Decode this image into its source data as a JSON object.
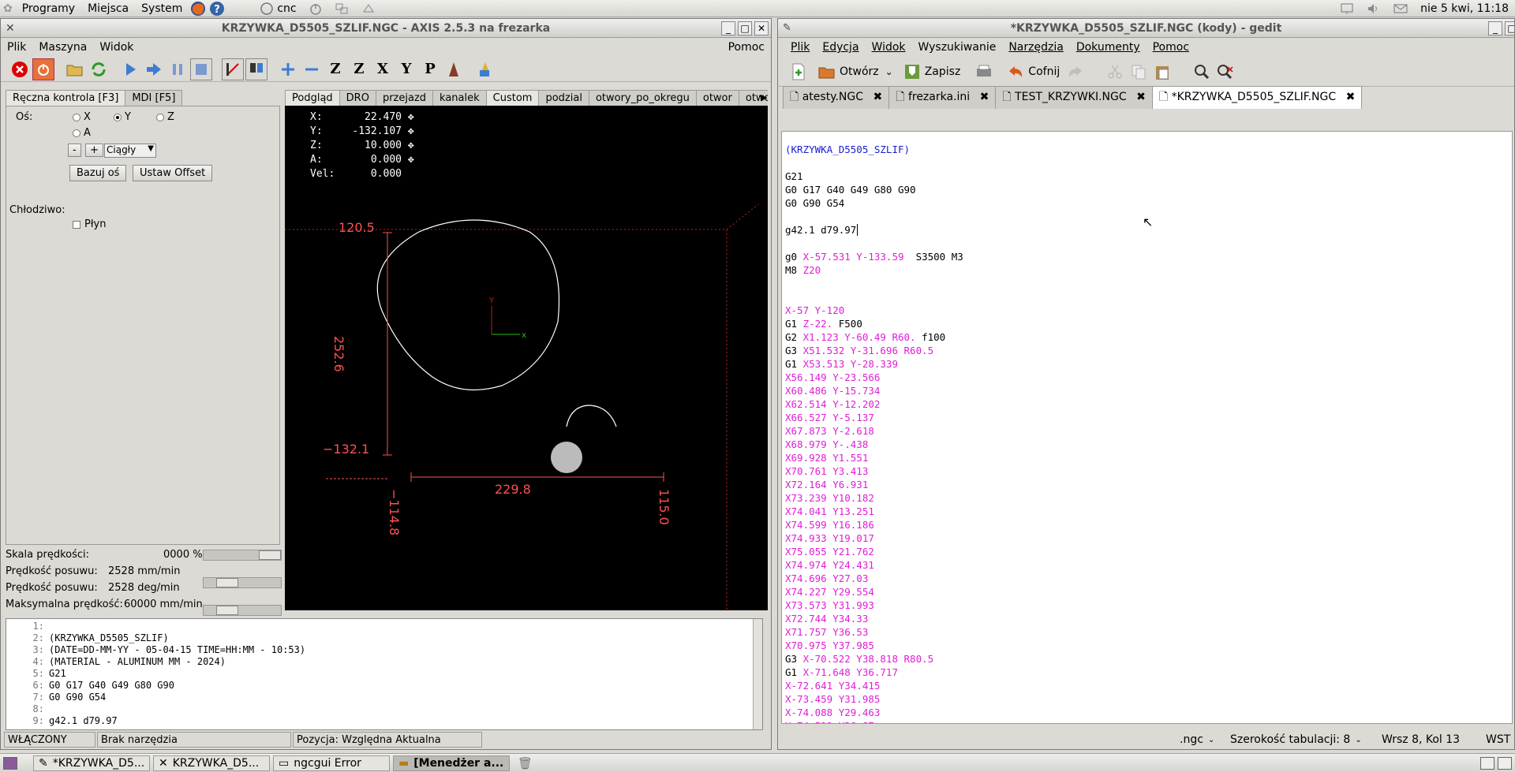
{
  "top_panel": {
    "menu_programs": "Programy",
    "menu_places": "Miejsca",
    "menu_system": "System",
    "launcher_cnc": "cnc",
    "clock": "nie 5 kwi, 11:18"
  },
  "axis": {
    "title": "KRZYWKA_D5505_SZLIF.NGC - AXIS 2.5.3 na frezarka",
    "menu": [
      "Plik",
      "Maszyna",
      "Widok"
    ],
    "menu_help": "Pomoc",
    "manual_tab": "Ręczna kontrola [F3]",
    "mdi_tab": "MDI [F5]",
    "axis_label": "Oś:",
    "axes": [
      "X",
      "Y",
      "Z",
      "A"
    ],
    "selected_axis": "Y",
    "jog_minus": "-",
    "jog_plus": "+",
    "jog_mode": "Ciągły",
    "home_button": "Bazuj oś",
    "offset_button": "Ustaw Offset",
    "coolant_label": "Chłodziwo:",
    "flood_label": "Płyn",
    "speed_scale_label": "Skala prędkości:",
    "speed_scale_value": "0000 %",
    "feed_label_1": "Prędkość posuwu:",
    "feed_value_1": "2528 mm/min",
    "feed_label_2": "Prędkość posuwu:",
    "feed_value_2": "2528 deg/min",
    "max_speed_label": "Maksymalna prędkość:",
    "max_speed_value": "60000 mm/min",
    "view_tabs": [
      "Podgląd",
      "DRO",
      "przejazd",
      "kanalek",
      "Custom",
      "podzial",
      "otwory_po_okregu",
      "otwor",
      "otwory_lini"
    ],
    "active_view_tab": "Podgląd",
    "dro": [
      {
        "label": "X:",
        "value": "22.470"
      },
      {
        "label": "Y:",
        "value": "-132.107"
      },
      {
        "label": "Z:",
        "value": "10.000"
      },
      {
        "label": "A:",
        "value": "0.000"
      },
      {
        "label": "Vel:",
        "value": "0.000"
      }
    ],
    "dims": {
      "top": "120.5",
      "height": "252.6",
      "bottom": "−132.1",
      "width": "229.8",
      "left": "−114.8",
      "right": "115.0"
    },
    "gcode_lines": [
      {
        "n": "1:",
        "t": ""
      },
      {
        "n": "2:",
        "t": "(KRZYWKA_D5505_SZLIF)"
      },
      {
        "n": "3:",
        "t": "(DATE=DD-MM-YY - 05-04-15 TIME=HH:MM - 10:53)"
      },
      {
        "n": "4:",
        "t": "(MATERIAL - ALUMINUM MM - 2024)"
      },
      {
        "n": "5:",
        "t": "G21"
      },
      {
        "n": "6:",
        "t": "G0 G17 G40 G49 G80 G90"
      },
      {
        "n": "7:",
        "t": "G0 G90 G54"
      },
      {
        "n": "8:",
        "t": ""
      },
      {
        "n": "9:",
        "t": "g42.1 d79.97"
      }
    ],
    "status": {
      "state": "WŁĄCZONY",
      "tool": "Brak narzędzia",
      "position": "Pozycja: Względna Aktualna"
    }
  },
  "gedit": {
    "title": "*KRZYWKA_D5505_SZLIF.NGC (kody) - gedit",
    "menu": [
      "Plik",
      "Edycja",
      "Widok",
      "Wyszukiwanie",
      "Narzędzia",
      "Dokumenty",
      "Pomoc"
    ],
    "toolbar": {
      "open": "Otwórz",
      "save": "Zapisz",
      "undo": "Cofnij"
    },
    "tabs": [
      "atesty.NGC",
      "frezarka.ini",
      "TEST_KRZYWKI.NGC",
      "*KRZYWKA_D5505_SZLIF.NGC"
    ],
    "lines": [
      [
        {
          "c": "b",
          "t": "(KRZYWKA_D5505_SZLIF)"
        }
      ],
      [],
      [
        {
          "c": "k",
          "t": "G21"
        }
      ],
      [
        {
          "c": "k",
          "t": "G0 G17 G40 G49 G80 G90"
        }
      ],
      [
        {
          "c": "k",
          "t": "G0 G90 G54"
        }
      ],
      [],
      [
        {
          "c": "k",
          "t": "g42.1 d79.97"
        }
      ],
      [],
      [
        {
          "c": "k",
          "t": "g0 "
        },
        {
          "c": "m",
          "t": "X-57.531 Y-133.59"
        },
        {
          "c": "k",
          "t": "  S3500 M3"
        }
      ],
      [
        {
          "c": "k",
          "t": "M8 "
        },
        {
          "c": "m",
          "t": "Z20"
        }
      ],
      [],
      [],
      [
        {
          "c": "m",
          "t": "X-57 Y-120"
        }
      ],
      [
        {
          "c": "k",
          "t": "G1 "
        },
        {
          "c": "m",
          "t": "Z-22."
        },
        {
          "c": "k",
          "t": " F500"
        }
      ],
      [
        {
          "c": "k",
          "t": "G2 "
        },
        {
          "c": "m",
          "t": "X1.123 Y-60.49 R60."
        },
        {
          "c": "k",
          "t": " f100"
        }
      ],
      [
        {
          "c": "k",
          "t": "G3 "
        },
        {
          "c": "m",
          "t": "X51.532 Y-31.696 R60.5"
        }
      ],
      [
        {
          "c": "k",
          "t": "G1 "
        },
        {
          "c": "m",
          "t": "X53.513 Y-28.339"
        }
      ],
      [
        {
          "c": "m",
          "t": "X56.149 Y-23.566"
        }
      ],
      [
        {
          "c": "m",
          "t": "X60.486 Y-15.734"
        }
      ],
      [
        {
          "c": "m",
          "t": "X62.514 Y-12.202"
        }
      ],
      [
        {
          "c": "m",
          "t": "X66.527 Y-5.137"
        }
      ],
      [
        {
          "c": "m",
          "t": "X67.873 Y-2.618"
        }
      ],
      [
        {
          "c": "m",
          "t": "X68.979 Y-.438"
        }
      ],
      [
        {
          "c": "m",
          "t": "X69.928 Y1.551"
        }
      ],
      [
        {
          "c": "m",
          "t": "X70.761 Y3.413"
        }
      ],
      [
        {
          "c": "m",
          "t": "X72.164 Y6.931"
        }
      ],
      [
        {
          "c": "m",
          "t": "X73.239 Y10.182"
        }
      ],
      [
        {
          "c": "m",
          "t": "X74.041 Y13.251"
        }
      ],
      [
        {
          "c": "m",
          "t": "X74.599 Y16.186"
        }
      ],
      [
        {
          "c": "m",
          "t": "X74.933 Y19.017"
        }
      ],
      [
        {
          "c": "m",
          "t": "X75.055 Y21.762"
        }
      ],
      [
        {
          "c": "m",
          "t": "X74.974 Y24.431"
        }
      ],
      [
        {
          "c": "m",
          "t": "X74.696 Y27.03"
        }
      ],
      [
        {
          "c": "m",
          "t": "X74.227 Y29.554"
        }
      ],
      [
        {
          "c": "m",
          "t": "X73.573 Y31.993"
        }
      ],
      [
        {
          "c": "m",
          "t": "X72.744 Y34.33"
        }
      ],
      [
        {
          "c": "m",
          "t": "X71.757 Y36.53"
        }
      ],
      [
        {
          "c": "m",
          "t": "X70.975 Y37.985"
        }
      ],
      [
        {
          "c": "k",
          "t": "G3 "
        },
        {
          "c": "m",
          "t": "X-70.522 Y38.818 R80.5"
        }
      ],
      [
        {
          "c": "k",
          "t": "G1 "
        },
        {
          "c": "m",
          "t": "X-71.648 Y36.717"
        }
      ],
      [
        {
          "c": "m",
          "t": "X-72.641 Y34.415"
        }
      ],
      [
        {
          "c": "m",
          "t": "X-73.459 Y31.985"
        }
      ],
      [
        {
          "c": "m",
          "t": "X-74.088 Y29.463"
        }
      ],
      [
        {
          "c": "m",
          "t": "X-74.519 Y26.87"
        }
      ],
      [
        {
          "c": "m",
          "t": "X-74.751 Y24.216"
        }
      ]
    ],
    "status": {
      "lang": ".ngc",
      "tab_width": "Szerokość tabulacji:  8",
      "cursor": "Wrsz 8, Kol 13",
      "mode": "WST"
    }
  },
  "taskbar": [
    {
      "label": "*KRZYWKA_D5...",
      "active": false
    },
    {
      "label": "KRZYWKA_D5...",
      "active": false
    },
    {
      "label": "ngcgui Error",
      "active": false
    },
    {
      "label": "[Menedżer a...",
      "active": true
    }
  ],
  "colors": {
    "gcode_blue": "#1c1cd0",
    "gcode_magenta": "#e01ed6",
    "preview_bg": "#000000",
    "preview_dim": "#ff4040"
  }
}
